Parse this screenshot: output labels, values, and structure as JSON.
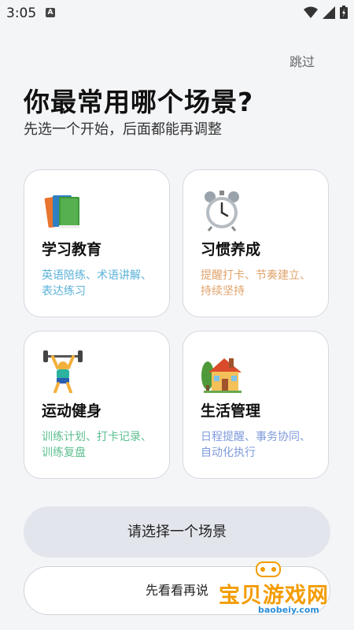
{
  "status_bar": {
    "time": "3:05",
    "app_indicator": "A",
    "icons": [
      "wifi-icon",
      "signal-icon",
      "battery-icon"
    ]
  },
  "header": {
    "skip_label": "跳过",
    "title": "你最常用哪个场景?",
    "subtitle": "先选一个开始，后面都能再调整"
  },
  "scenes": [
    {
      "icon": "books-icon",
      "label": "学习教育",
      "desc": "英语陪练、术语讲解、表达练习",
      "color": "#5ab1d8"
    },
    {
      "icon": "alarm-clock-icon",
      "label": "习惯养成",
      "desc": "提醒打卡、节奏建立、持续坚持",
      "color": "#e0a36b"
    },
    {
      "icon": "weightlifter-icon",
      "label": "运动健身",
      "desc": "训练计划、打卡记录、训练复盘",
      "color": "#5cbf8f"
    },
    {
      "icon": "house-icon",
      "label": "生活管理",
      "desc": "日程提醒、事务协同、自动化执行",
      "color": "#7f9bdc"
    }
  ],
  "actions": {
    "primary_label": "请选择一个场景",
    "secondary_label": "先看看再说"
  },
  "watermark": {
    "text": "宝贝游戏网",
    "url": "baobeiy.com"
  }
}
